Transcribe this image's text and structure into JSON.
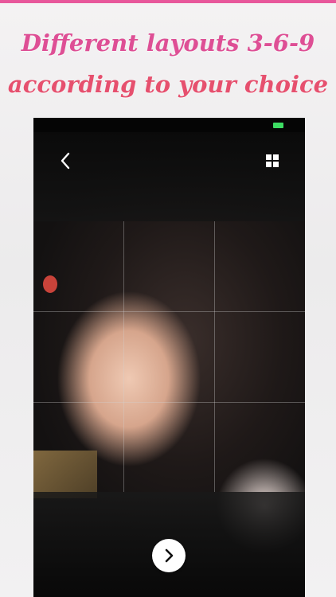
{
  "headline": {
    "line1": "Different layouts 3-6-9",
    "line2": "according to your choice"
  },
  "toolbar": {
    "back_icon": "chevron-left-icon",
    "layout_icon": "grid-2x2-icon"
  },
  "editor": {
    "grid_layout": "3x3",
    "next_icon": "chevron-right-icon"
  },
  "colors": {
    "headline_pink": "#de4f95",
    "headline_coral": "#e6506e",
    "battery_green": "#3ddc63",
    "top_stripe": "#e8579b"
  }
}
